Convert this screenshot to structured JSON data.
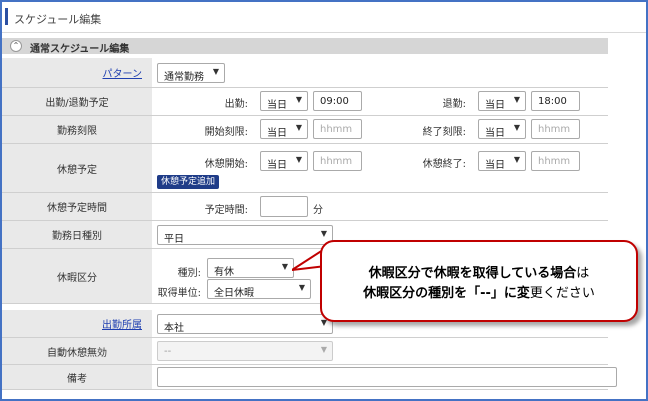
{
  "header": {
    "title": "スケジュール編集"
  },
  "section": {
    "title": "通常スケジュール編集",
    "collapse_icon": "chevron-up-icon"
  },
  "pattern": {
    "label": "パターン",
    "value": "通常勤務"
  },
  "attendance": {
    "label": "出勤/退勤予定",
    "in_label": "出勤:",
    "in_day": "当日",
    "in_time": "09:00",
    "out_label": "退勤:",
    "out_day": "当日",
    "out_time": "18:00"
  },
  "work_time": {
    "label": "勤務刻限",
    "start_label": "開始刻限:",
    "start_day": "当日",
    "start_placeholder": "hhmm",
    "end_label": "終了刻限:",
    "end_day": "当日",
    "end_placeholder": "hhmm"
  },
  "break": {
    "label": "休憩予定",
    "start_label": "休憩開始:",
    "start_day": "当日",
    "start_placeholder": "hhmm",
    "end_label": "休憩終了:",
    "end_day": "当日",
    "end_placeholder": "hhmm",
    "add_button": "休憩予定追加"
  },
  "break_plan": {
    "label": "休憩予定時間",
    "time_label": "予定時間:",
    "unit": "分"
  },
  "day_type": {
    "label": "勤務日種別",
    "value": "平日"
  },
  "leave": {
    "label": "休暇区分",
    "kind_label": "種別:",
    "kind_value": "有休",
    "unit_label": "取得単位:",
    "unit_value": "全日休暇"
  },
  "department": {
    "label": "出勤所属",
    "value": "本社"
  },
  "auto_break": {
    "label": "自動休憩無効",
    "value": "--"
  },
  "remarks": {
    "label": "備考",
    "value": ""
  },
  "callout": {
    "line1_bold": "休暇区分で休暇を取得している場合",
    "line1_rest": "は",
    "line2_bold1": "休暇区分の種別を「--」に変",
    "line2_rest": "更ください",
    "border_color": "#c00000"
  },
  "colors": {
    "accent": "#2b4fa2",
    "add_button": "#1f3c88",
    "link": "#1f3fb0"
  }
}
